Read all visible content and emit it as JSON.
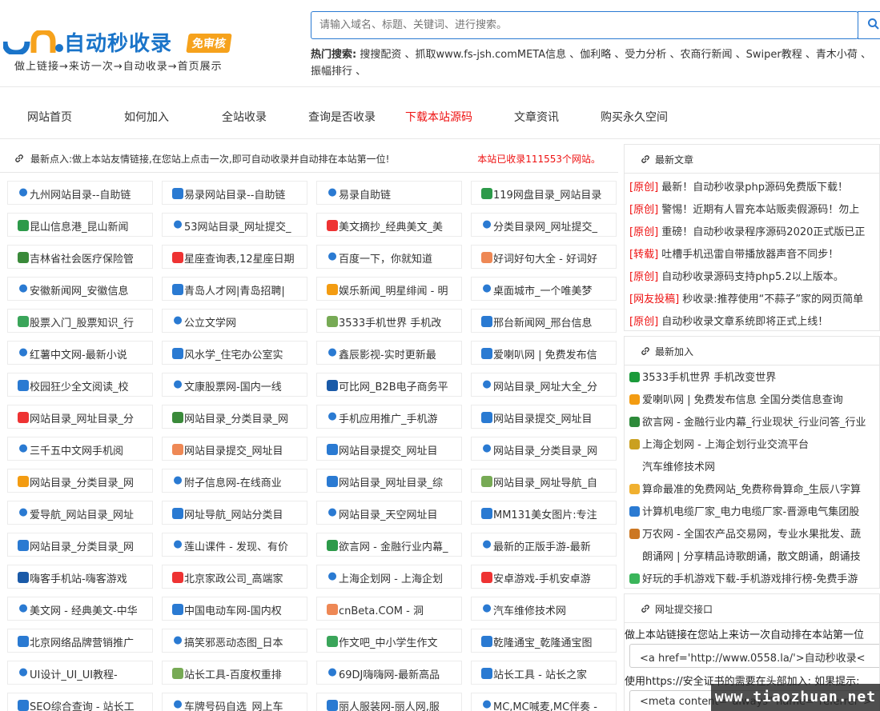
{
  "header": {
    "logo_name": "自动秒收录",
    "logo_badge": "免审核",
    "slogan": "做上链接→来访一次→自动收录→首页展示",
    "search_placeholder": "请输入域名、标题、关键词、进行搜索。",
    "hot_title": "热门搜索:",
    "hot_keywords": "搜搜配资 、抓取www.fs-jsh.comMETA信息 、伽利略 、受力分析 、农商行新闻 、Swiper教程 、青木小荷 、振幅排行 、"
  },
  "nav": [
    {
      "label": "网站首页",
      "active": false
    },
    {
      "label": "如何加入",
      "active": false
    },
    {
      "label": "全站收录",
      "active": false
    },
    {
      "label": "查询是否收录",
      "active": false
    },
    {
      "label": "下载本站源码",
      "active": true
    },
    {
      "label": "文章资讯",
      "active": false
    },
    {
      "label": "购买永久空间",
      "active": false
    }
  ],
  "notice": {
    "text": "最新点入:做上本站友情链接,在您站上点击一次,即可自动收录并自动排在本站第一位!",
    "count": "本站已收录111553个网站。"
  },
  "sites": [
    [
      "九州网站目录--自助链",
      "易录网站目录--自助链",
      "易录自助链",
      "119网盘目录_网站目录"
    ],
    [
      "昆山信息港_昆山新闻",
      "53网站目录_网址提交_",
      "美文摘抄_经典美文_美",
      "分类目录网_网址提交_"
    ],
    [
      "吉林省社会医疗保险管",
      "星座查询表,12星座日期",
      "百度一下，你就知道",
      "好词好句大全 - 好词好"
    ],
    [
      "安徽新闻网_安徽信息",
      "青岛人才网|青岛招聘|",
      "娱乐新闻_明星绯闻 - 明",
      "桌面城市_一个唯美梦"
    ],
    [
      "股票入门_股票知识_行",
      "公立文学网",
      "3533手机世界 手机改",
      "邢台新闻网_邢台信息"
    ],
    [
      "红薯中文网-最新小说",
      "风水学_住宅办公室实",
      "鑫辰影视-实时更新最",
      "爱喇叭网 | 免费发布信"
    ],
    [
      "校园狂少全文阅读_校",
      "文康股票网-国内一线",
      "可比网_B2B电子商务平",
      "网站目录_网址大全_分"
    ],
    [
      "网站目录_网址目录_分",
      "网站目录_分类目录_网",
      "手机应用推广_手机游",
      "网站目录提交_网址目"
    ],
    [
      "三千五中文网手机阅",
      "网站目录提交_网址目",
      "网站目录提交_网址目",
      "网站目录_分类目录_网"
    ],
    [
      "网站目录_分类目录_网",
      "附子信息网-在线商业",
      "网站目录_网址目录_综",
      "网站目录_网址导航_自"
    ],
    [
      "爱导航_网站目录_网址",
      "网址导航_网站分类目",
      "网站目录_天空网址目",
      "MM131美女图片:专注"
    ],
    [
      "网站目录_分类目录_网",
      "莲山课件 - 发现、有价",
      "欲言网 - 金融行业内幕_",
      "最新的正版手游-最新"
    ],
    [
      "嗨客手机站-嗨客游戏",
      "北京家政公司_高端家",
      "上海企划网 - 上海企划",
      "安卓游戏-手机安卓游"
    ],
    [
      "美文网 - 经典美文-中华",
      "中国电动车网-国内权",
      "cnBeta.COM - 洞",
      "汽车维修技术网"
    ],
    [
      "北京网络品牌营销推广",
      "搞笑邪恶动态图_日本",
      "作文吧_中小学生作文",
      "乾隆通宝_乾隆通宝图"
    ],
    [
      "UI设计_UI_UI教程-",
      "站长工具-百度权重排",
      "69DJ嗨嗨网-最新高品",
      "站长工具 - 站长之家"
    ],
    [
      "SEO综合查询 - 站长工",
      "车牌号码自选_网上车",
      "丽人服装网-丽人网,服",
      "MC,MC喊麦,MC伴奏 -"
    ]
  ],
  "sidebar": {
    "articles_title": "最新文章",
    "articles": [
      {
        "tag": "[原创]",
        "text": "最新！自动秒收录php源码免费版下载！"
      },
      {
        "tag": "[原创]",
        "text": "警惕！近期有人冒充本站贩卖假源码！勿上"
      },
      {
        "tag": "[原创]",
        "text": "重磅！自动秒收录程序源码2020正式版已正"
      },
      {
        "tag": "[转载]",
        "text": "吐槽手机迅雷自带播放器声音不同步！"
      },
      {
        "tag": "[原创]",
        "text": "自动秒收录源码支持php5.2以上版本。"
      },
      {
        "tag": "[网友投稿]",
        "text": "秒收录:推荐使用“不蒜子”家的网页简单"
      },
      {
        "tag": "[原创]",
        "text": "自动秒收录文章系统即将正式上线！"
      }
    ],
    "new_title": "最新加入",
    "new_sites": [
      "3533手机世界 手机改变世界",
      "爱喇叭网 | 免费发布信息 全国分类信息查询",
      "欲言网 - 金融行业内幕_行业现状_行业问答_行业",
      "上海企划网 - 上海企划行业交流平台",
      "汽车维修技术网",
      "算命最准的免费网站_免费称骨算命_生辰八字算",
      "计算机电缆厂家_电力电缆厂家-晋源电气集团股",
      "万农网 - 全国农产品交易网，专业水果批发、蔬",
      "朗诵网 | 分享精品诗歌朗诵，散文朗诵，朗诵技",
      "好玩的手机游戏下载-手机游戏排行榜-免费手游"
    ],
    "submit_title": "网址提交接口",
    "submit_line1": "做上本站链接在您站上来访一次自动排在本站第一位",
    "submit_code1": "<a href='http://www.0558.la/'>自动秒收录<",
    "submit_line2": "使用https://安全证书的需要在头部加入: 如果提示:",
    "submit_code2": "<meta content=\"always\" name=\"referrer\">"
  },
  "watermark": "www.tiaozhuan.net"
}
